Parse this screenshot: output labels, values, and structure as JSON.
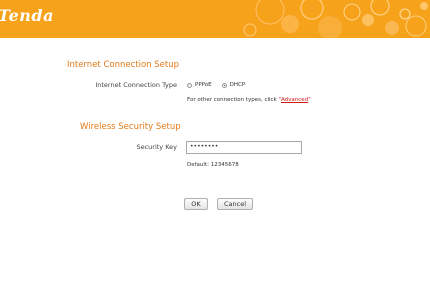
{
  "header": {
    "logo_text": "Tenda",
    "brand_color": "#f7a21b"
  },
  "internet_setup": {
    "title": "Internet Connection Setup",
    "type_label": "Internet Connection Type",
    "options": [
      {
        "label": "PPPoE",
        "selected": false
      },
      {
        "label": "DHCP",
        "selected": true
      }
    ],
    "hint_prefix": "For other connection types, click",
    "hint_link": "Advanced"
  },
  "wireless_setup": {
    "title": "Wireless Security Setup",
    "key_label": "Security Key",
    "key_value": "••••••••",
    "default_text": "Default: 12345678"
  },
  "buttons": {
    "ok_label": "OK",
    "cancel_label": "Cancel"
  }
}
